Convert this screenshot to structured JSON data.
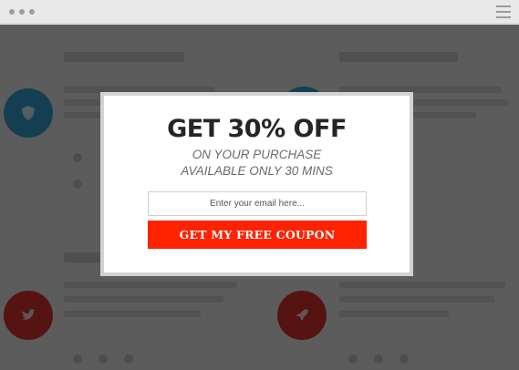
{
  "window": {
    "controls": [
      "dot-1",
      "dot-2",
      "dot-3"
    ],
    "menu_icon": "hamburger-menu-icon"
  },
  "background": {
    "circles": [
      {
        "color": "#35a7d8",
        "icon": "shield-icon"
      },
      {
        "color": "#35a7d8",
        "icon": "shield-icon"
      },
      {
        "color": "#e0322f",
        "icon": "twitter-bird-icon"
      },
      {
        "color": "#e0322f",
        "icon": "rocket-icon"
      }
    ]
  },
  "popup": {
    "headline": "GET 30% OFF",
    "subline_1": "ON YOUR PURCHASE",
    "subline_2": "AVAILABLE ONLY 30 MINS",
    "email_placeholder": "Enter your email here...",
    "email_value": "",
    "cta_label": "GET MY FREE COUPON",
    "cta_color": "#ff2200"
  }
}
